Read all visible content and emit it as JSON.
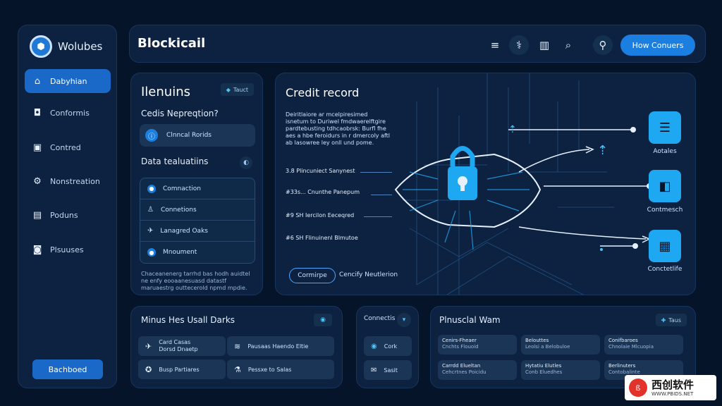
{
  "sidebar": {
    "brand": "Wolubes",
    "items": [
      {
        "label": "Dabyhian",
        "icon": "home-icon",
        "active": true
      },
      {
        "label": "Conformis",
        "icon": "chat-icon",
        "active": false
      },
      {
        "label": "Contred",
        "icon": "screen-icon",
        "active": false
      },
      {
        "label": "Nonstreation",
        "icon": "gear-icon",
        "active": false
      },
      {
        "label": "Poduns",
        "icon": "document-icon",
        "active": false
      },
      {
        "label": "Plsuuses",
        "icon": "image-icon",
        "active": false
      }
    ],
    "bottom_button": "Bachboed"
  },
  "topbar": {
    "brand": "Blockicail",
    "cta": "How Conuers"
  },
  "menu_panel": {
    "title": "Ilenuins",
    "chip": "Tauct",
    "question": "Cedis Nepreqtion?",
    "selected": "Clnncal Rorids",
    "subtitle": "Data tealuatiins",
    "list": [
      "Comnaction",
      "Connetions",
      "Lanagred Oaks",
      "Mnoument"
    ],
    "footnote": "Chaceanenerg tarrhd bas hodh auidtel ne enfy eooaanesuasd datastf maruaestrg outtecerold npmd mpdie."
  },
  "hero": {
    "title": "Credit record",
    "description": "Deiritlaiore ar mcelpiresimed isnetum to Duriwel fmdwaerelftgire pardtebusting tdhcaobrsk: Burfl fhe aes a hbe feroidurs in r dmercoly aftl ab lasowree ley onll und pome.",
    "features": [
      "3.8 Plincuniect Sanynest",
      "#33s... Cnunthe Panepum",
      "#9 SH Iercilon Eeceqred",
      "#6 SH Flinuinenl Blmutoe"
    ],
    "btn_primary": "Cormirpe",
    "btn_secondary": "Cencify Neutlerion",
    "tiles": [
      {
        "label": "Aotales",
        "icon": "stack-icon"
      },
      {
        "label": "Contmesch",
        "icon": "bag-icon"
      },
      {
        "label": "Conctetlife",
        "icon": "building-icon"
      }
    ]
  },
  "bottom_left": {
    "title": "Minus Hes Usall Darks",
    "cards": [
      {
        "line1": "Card Casas",
        "line2": "Dorsd Dnaetp",
        "icon": "plane-icon"
      },
      {
        "label": "Pausaas Haendo Eltie",
        "icon": "wifi-icon"
      },
      {
        "label": "Busp Partiares",
        "icon": "badge-icon"
      },
      {
        "label": "Pessxe to Salas",
        "icon": "flask-icon"
      }
    ]
  },
  "bottom_mid": {
    "title": "Connectis",
    "rows": [
      {
        "label": "Cork",
        "icon": "target-icon"
      },
      {
        "label": "Sasit",
        "icon": "mail-icon"
      }
    ]
  },
  "bottom_right": {
    "title": "Plnusclal Wam",
    "tag": "Taus",
    "cells": [
      {
        "t": "Cenirs-Fheaer",
        "s": "Cnchts Flouoid"
      },
      {
        "t": "Belouttes",
        "s": "Leolsi a Belobuloe"
      },
      {
        "t": "Conifbaroes",
        "s": "Chnolaie Mlcuopia"
      },
      {
        "t": "Carrdd Elueltan",
        "s": "Cehcrtnes Poicidu"
      },
      {
        "t": "Hytatiu Elutles",
        "s": "Conb Eluedhes"
      },
      {
        "t": "Berlinuters",
        "s": "Contobalinte"
      }
    ]
  },
  "watermark": {
    "logo_text": "ß",
    "name": "西创软件",
    "url": "WWW.PBIDS.NET"
  }
}
